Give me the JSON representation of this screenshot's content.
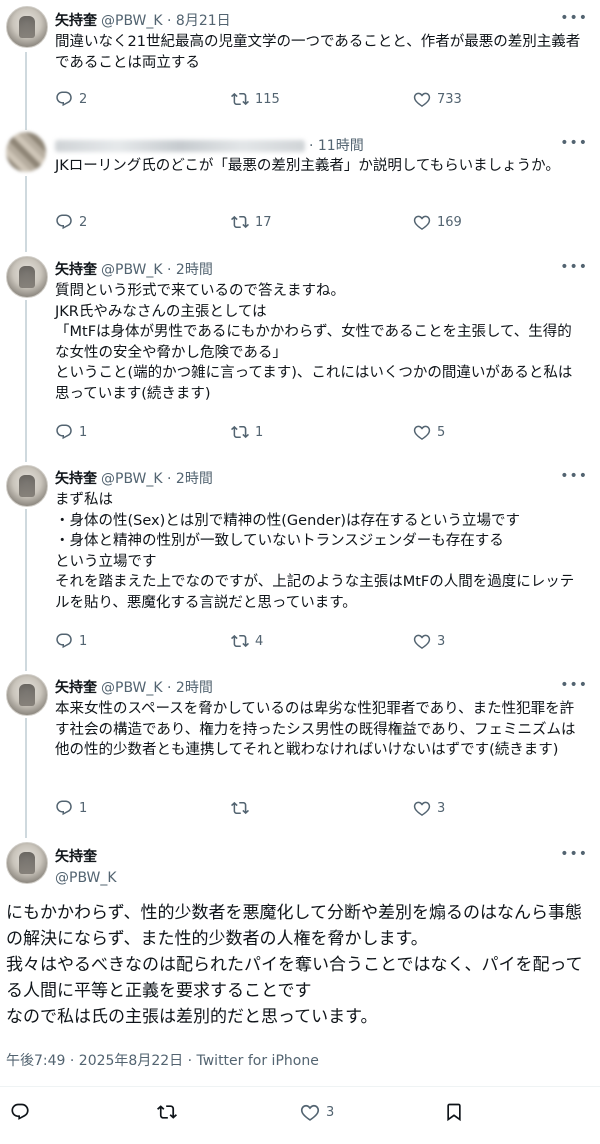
{
  "tweets": [
    {
      "name": "矢持奎",
      "handle_time": "@PBW_K · 8月21日",
      "text": "間違いなく21世紀最高の児童文学の一つであることと、作者が最悪の差別主義者であることは両立する",
      "replies": "2",
      "retweets": "115",
      "likes": "733"
    },
    {
      "name": "",
      "handle_time": "· 11時間",
      "text": "JKローリング氏のどこが「最悪の差別主義者」か説明してもらいましょうか。",
      "replies": "2",
      "retweets": "17",
      "likes": "169"
    },
    {
      "name": "矢持奎",
      "handle_time": "@PBW_K · 2時間",
      "text": "質問という形式で来ているので答えますね。\nJKR氏やみなさんの主張としては\n「MtFは身体が男性であるにもかかわらず、女性であることを主張して、生得的な女性の安全や脅かし危険である」\nということ(端的かつ雑に言ってます)、これにはいくつかの間違いがあると私は思っています(続きます)",
      "replies": "1",
      "retweets": "1",
      "likes": "5"
    },
    {
      "name": "矢持奎",
      "handle_time": "@PBW_K · 2時間",
      "text": "まず私は\n・身体の性(Sex)とは別で精神の性(Gender)は存在するという立場です\n・身体と精神の性別が一致していないトランスジェンダーも存在する\nという立場です\nそれを踏まえた上でなのですが、上記のような主張はMtFの人間を過度にレッテルを貼り、悪魔化する言説だと思っています。",
      "replies": "1",
      "retweets": "4",
      "likes": "3"
    },
    {
      "name": "矢持奎",
      "handle_time": "@PBW_K · 2時間",
      "text": "本来女性のスペースを脅かしているのは卑劣な性犯罪者であり、また性犯罪を許す社会の構造であり、権力を持ったシス男性の既得権益であり、フェミニズムは他の性的少数者とも連携してそれと戦わなければいけないはずです(続きます)",
      "replies": "1",
      "retweets": "",
      "likes": "3"
    }
  ],
  "main_tweet": {
    "name": "矢持奎",
    "handle": "@PBW_K",
    "text": "にもかかわらず、性的少数者を悪魔化して分断や差別を煽るのはなんら事態の解決にならず、また性的少数者の人権を脅かします。\n我々はやるべきなのは配られたパイを奪い合うことではなく、パイを配ってる人間に平等と正義を要求することです\nなので私は氏の主張は差別的だと思っています。",
    "meta": "午後7:49 · 2025年8月22日 · Twitter for iPhone",
    "likes": "3"
  },
  "more_glyph": "•••",
  "icons": {
    "reply": "reply-icon",
    "retweet": "retweet-icon",
    "like": "heart-icon",
    "bookmark": "bookmark-icon",
    "more": "more-icon"
  },
  "colors": {
    "text": "#0f1419",
    "secondary": "#536471",
    "line": "#cfd9de"
  }
}
